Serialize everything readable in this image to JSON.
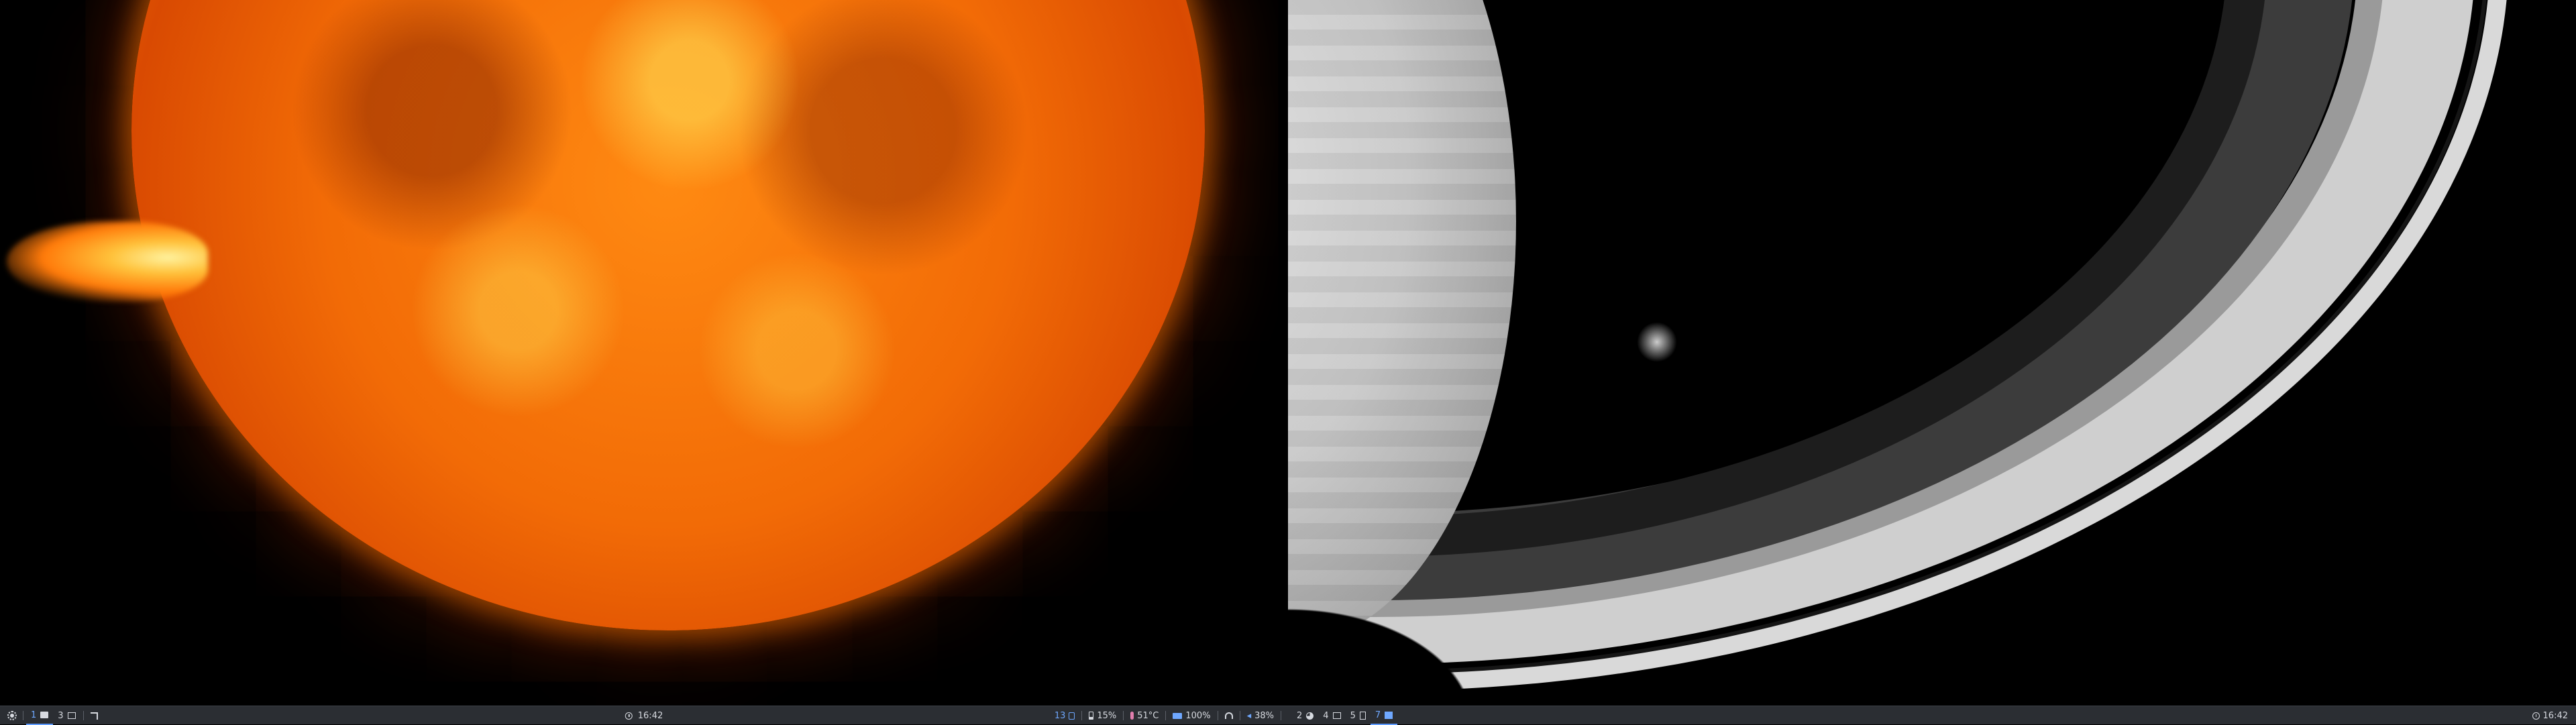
{
  "left_bar": {
    "workspaces": [
      {
        "label": "1",
        "icon": "folder-icon",
        "active": true
      },
      {
        "label": "3",
        "icon": "window-icon",
        "active": false
      }
    ],
    "clock": "16:42",
    "status": {
      "cpu_tag": "13",
      "battery": "15%",
      "temperature": "51°C",
      "memory": "100%",
      "volume": "38%"
    }
  },
  "right_bar": {
    "workspaces": [
      {
        "label": "2",
        "icon": "pie-icon",
        "active": false
      },
      {
        "label": "4",
        "icon": "image-icon",
        "active": false
      },
      {
        "label": "5",
        "icon": "doc-icon",
        "active": false
      },
      {
        "label": "7",
        "icon": "app-icon",
        "active": true
      }
    ],
    "clock": "16:42"
  },
  "colors": {
    "bar_bg": "#2b2e33",
    "accent_blue": "#6fa8ff",
    "accent_pink": "#e27fae",
    "text": "#d7dae0"
  }
}
